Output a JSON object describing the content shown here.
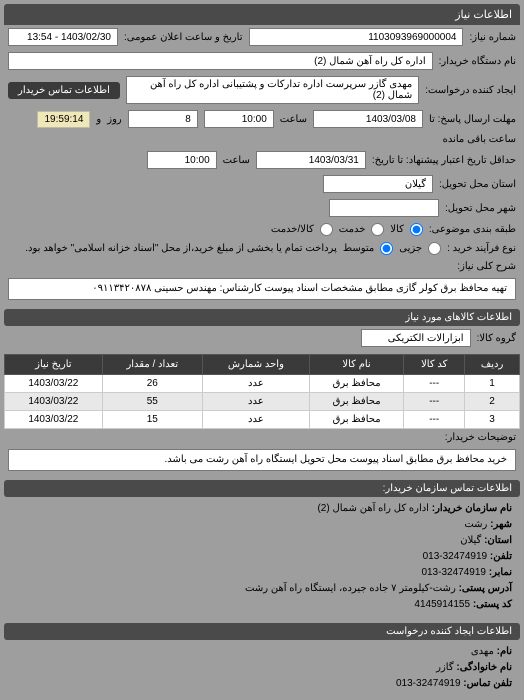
{
  "header": {
    "title": "اطلاعات نیاز"
  },
  "fields": {
    "request_number_label": "شماره نیاز:",
    "request_number": "1103093969000004",
    "announce_label": "تاریخ و ساعت اعلان عمومی:",
    "announce_value": "1403/02/30 - 13:54",
    "buyer_name_label": "نام دستگاه خریدار:",
    "buyer_name": "اداره کل راه آهن شمال (2)",
    "requester_label": "ایجاد کننده درخواست:",
    "requester": "مهدی گازر سرپرست اداره تدارکات و پشتیبانی اداره کل راه آهن شمال (2)",
    "contact_btn": "اطلاعات تماس خریدار",
    "deadline_send_label": "مهلت ارسال پاسخ: تا",
    "deadline_date": "1403/03/08",
    "time_label": "ساعت",
    "deadline_time": "10:00",
    "days_label": "و",
    "days_value": "8",
    "days_suffix": "روز",
    "remaining_value": "19:59:14",
    "remaining_label": "ساعت باقی مانده",
    "validity_label": "حداقل تاریخ اعتبار پیشنهاد: تا تاریخ:",
    "validity_date": "1403/03/31",
    "validity_time": "10:00",
    "province_label": "استان محل تحویل:",
    "province": "گیلان",
    "city_label": "شهر محل تحویل:",
    "packaging_label": "طبقه بندی موضوعی:",
    "pkg_goods": "کالا",
    "pkg_service": "خدمت",
    "pkg_both": "کالا/خدمت",
    "process_label": "نوع فرآیند خرید :",
    "proc_partial": "جزیی",
    "proc_medium": "متوسط",
    "process_note": "پرداخت تمام یا بخشی از مبلغ خرید،از محل \"اسناد خزانه اسلامی\" خواهد بود."
  },
  "desc": {
    "label": "شرح کلی نیاز:",
    "text": "تهیه محافظ برق کولر گازی مطابق مشخصات اسناد پیوست کارشناس: مهندس حسینی ۰۹۱۱۳۴۲۰۸۷۸"
  },
  "goods_header": "اطلاعات کالاهای مورد نیاز",
  "group_label": "گروه کالا:",
  "group_value": "ابزارالات الکتریکی",
  "table": {
    "headers": [
      "ردیف",
      "کد کالا",
      "نام کالا",
      "واحد شمارش",
      "تعداد / مقدار",
      "تاریخ نیاز"
    ],
    "rows": [
      [
        "1",
        "---",
        "محافظ برق",
        "عدد",
        "26",
        "1403/03/22"
      ],
      [
        "2",
        "---",
        "محافظ برق",
        "عدد",
        "55",
        "1403/03/22"
      ],
      [
        "3",
        "---",
        "محافظ برق",
        "عدد",
        "15",
        "1403/03/22"
      ]
    ]
  },
  "buyer_note_label": "توضیحات خریدار:",
  "buyer_note": "خرید محافظ برق مطابق  اسناد پیوست محل تحویل ایستگاه راه آهن رشت می باشد.",
  "contact_header": "اطلاعات تماس سازمان خریدار:",
  "contact": {
    "org_label": "نام سازمان خریدار:",
    "org": "اداره کل راه آهن شمال (2)",
    "city_label": "شهر:",
    "city": "رشت",
    "province_label": "استان:",
    "province": "گیلان",
    "phone_label": "تلفن:",
    "phone": "32474919-013",
    "fax_label": "نمابر:",
    "fax": "32474919-013",
    "address_label": "آدرس پستی:",
    "address": "رشت-کیلومتر ۷ جاده جیرده، ایستگاه راه آهن رشت",
    "postal_label": "کد پستی:",
    "postal": "4145914155"
  },
  "creator_header": "اطلاعات ایجاد کننده درخواست",
  "creator": {
    "name_label": "نام:",
    "name": "مهدی",
    "family_label": "نام خانوادگی:",
    "family": "گازر",
    "phone_label": "تلفن تماس:",
    "phone": "32474919-013"
  }
}
